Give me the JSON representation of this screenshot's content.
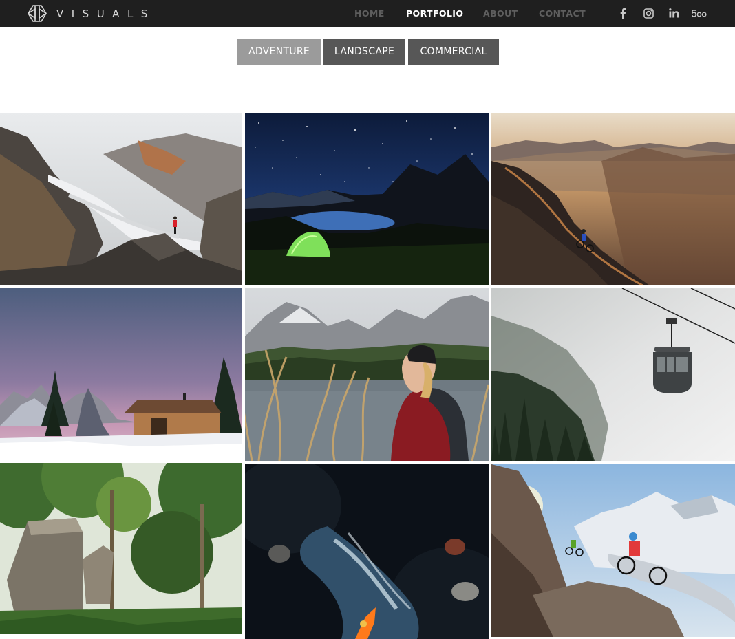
{
  "brand": {
    "name": "VISUALS",
    "text_color": "#d9d9d9"
  },
  "nav": {
    "items": [
      {
        "label": "HOME",
        "active": false
      },
      {
        "label": "PORTFOLIO",
        "active": true
      },
      {
        "label": "ABOUT",
        "active": false
      },
      {
        "label": "CONTACT",
        "active": false
      }
    ],
    "bg_color": "#1f1f1f",
    "inactive_color": "#5e5e5e",
    "active_color": "#ffffff"
  },
  "social": [
    {
      "icon": "facebook-icon",
      "glyph": "f"
    },
    {
      "icon": "instagram-icon",
      "glyph": ""
    },
    {
      "icon": "linkedin-icon",
      "glyph": "in"
    },
    {
      "icon": "500px-icon",
      "glyph": "500"
    }
  ],
  "filters": [
    {
      "label": "ADVENTURE",
      "active": true,
      "color": "#9b9b9b"
    },
    {
      "label": "LANDSCAPE",
      "active": false,
      "color": "#575757"
    },
    {
      "label": "COMMERCIAL",
      "active": false,
      "color": "#575757"
    }
  ],
  "gallery": {
    "photos": [
      {
        "name": "photo-glacier-hiker",
        "subject": "hiker on rocky peak overlooking glacier"
      },
      {
        "name": "photo-night-tent",
        "subject": "glowing tent under starry sky by lake"
      },
      {
        "name": "photo-mountain-biker-sunset",
        "subject": "mountain biker on ridge at sunset"
      },
      {
        "name": "photo-snowy-cabin",
        "subject": "wooden cabin in snow at dusk"
      },
      {
        "name": "photo-woman-lake",
        "subject": "woman in red jacket by alpine lake"
      },
      {
        "name": "photo-cable-car-fog",
        "subject": "cable car gondola in fog"
      },
      {
        "name": "photo-forest-cabins",
        "subject": "wooden treehouse cabins in forest"
      },
      {
        "name": "photo-kayak-river",
        "subject": "kayaker in rushing river from above"
      },
      {
        "name": "photo-bikers-glacier",
        "subject": "two mountain bikers near glacier"
      }
    ]
  }
}
